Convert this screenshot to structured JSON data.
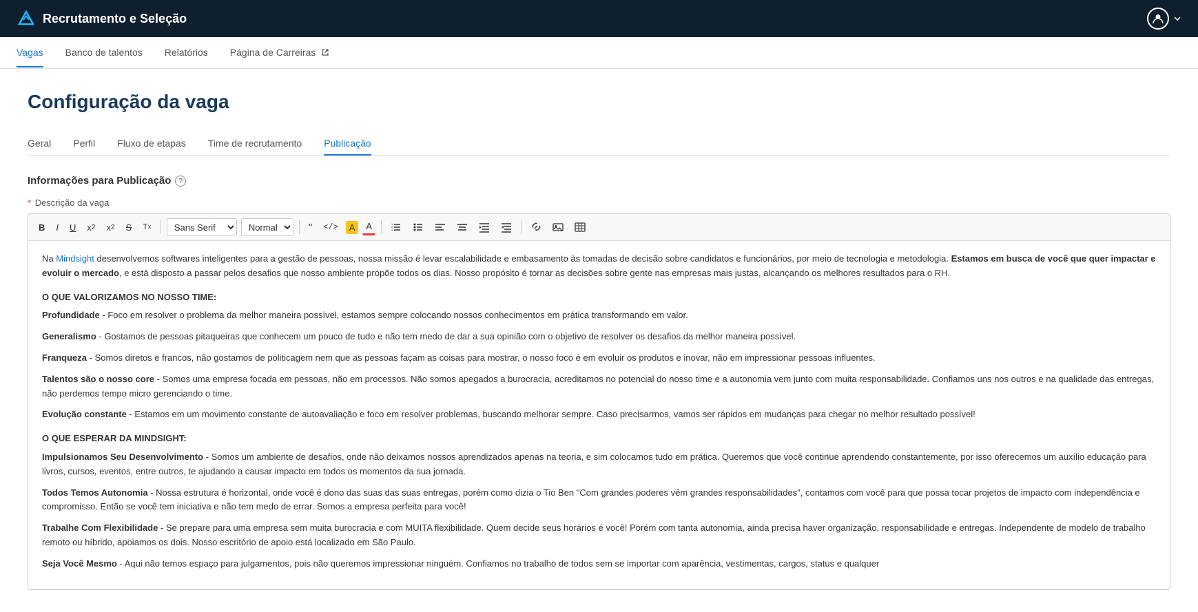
{
  "brand": {
    "name": "Recrutamento e Seleção"
  },
  "sub_nav": {
    "items": [
      {
        "id": "vagas",
        "label": "Vagas",
        "active": true
      },
      {
        "id": "banco-talentos",
        "label": "Banco de talentos",
        "active": false
      },
      {
        "id": "relatorios",
        "label": "Relatórios",
        "active": false
      },
      {
        "id": "pagina-carreiras",
        "label": "Página de Carreiras",
        "active": false,
        "external": true
      }
    ]
  },
  "page": {
    "title": "Configuração da vaga"
  },
  "tabs": [
    {
      "id": "geral",
      "label": "Geral",
      "active": false
    },
    {
      "id": "perfil",
      "label": "Perfil",
      "active": false
    },
    {
      "id": "fluxo-etapas",
      "label": "Fluxo de etapas",
      "active": false
    },
    {
      "id": "time-recrutamento",
      "label": "Time de recrutamento",
      "active": false
    },
    {
      "id": "publicacao",
      "label": "Publicação",
      "active": true
    }
  ],
  "section": {
    "title": "Informações para Publicação"
  },
  "field": {
    "label": "Descrição da vaga",
    "required": true
  },
  "toolbar": {
    "font_family": "Sans Serif",
    "font_size": "Normal"
  },
  "editor_content": {
    "intro": "Na Mindsight desenvolvemos softwares inteligentes para a gestão de pessoas, nossa missão é levar escalabilidade e embasamento às tomadas de decisão sobre candidatos e funcionários, por meio de tecnologia e metodologia.",
    "intro_bold": "Estamos em busca de você que quer impactar e evoluir o mercado",
    "intro_end": ", e está disposto a passar pelos desafios que nosso ambiente propõe todos os dias. Nosso propósito é tornar as decisões sobre gente nas empresas mais justas, alcançando os melhores resultados para o RH.",
    "section1_title": "O QUE VALORIZAMOS NO NOSSO TIME:",
    "items1": [
      {
        "title": "Profundidade",
        "text": " - Foco em resolver o problema da melhor maneira possível, estamos sempre colocando nossos conhecimentos em prática transformando em valor."
      },
      {
        "title": "Generalismo",
        "text": " - Gostamos de pessoas pitaqueiras que conhecem um pouco de tudo e não tem medo de dar a sua opinião com o objetivo de resolver os desafios da melhor maneira possível."
      },
      {
        "title": "Franqueza",
        "text": " - Somos diretos e francos, não gostamos de politicagem nem que as pessoas façam as coisas para mostrar, o nosso foco é em evoluir os produtos e inovar, não em impressionar pessoas influentes."
      },
      {
        "title": "Talentos são o nosso core",
        "text": " - Somos uma empresa focada em pessoas, não em processos. Não somos apegados a burocracia, acreditamos no potencial do nosso time e a autonomia vem junto com muita responsabilidade. Confiamos uns nos outros e na qualidade das entregas, não perdemos tempo micro gerenciando o time."
      },
      {
        "title": "Evolução constante",
        "text": " - Estamos em um movimento constante de autoavaliação e foco em resolver problemas, buscando melhorar sempre. Caso precisarmos, vamos ser rápidos em mudanças para chegar no melhor resultado possível!"
      }
    ],
    "section2_title": "O QUE ESPERAR DA MINDSIGHT:",
    "items2": [
      {
        "title": "Impulsionamos Seu Desenvolvimento",
        "text": " - Somos um ambiente de desafios, onde não deixamos nossos aprendizados apenas na teoria, e sim colocamos tudo em prática. Queremos que você continue aprendendo constantemente, por isso oferecemos um auxílio educação para livros, cursos, eventos, entre outros, te ajudando a causar impacto em todos os momentos da sua jornada."
      },
      {
        "title": "Todos Temos Autonomia",
        "text": " - Nossa estrutura é horizontal, onde você é dono das suas das suas entregas, porém como dizia o Tio Ben \"Com grandes poderes vêm grandes responsabilidades\", contamos com você para que possa tocar projetos de impacto com independência e compromisso. Então se você tem iniciativa e não tem medo de errar. Somos a empresa perfeita para você!"
      },
      {
        "title": "Trabalhe Com Flexibilidade",
        "text": " - Se prepare para uma empresa sem muita burocracia e com MUITA flexibilidade. Quem decide seus horários é você! Porém com tanta autonomia, ainda precisa haver organização, responsabilidade e entregas. Independente de modelo de trabalho remoto ou híbrido, apoiamos os dois. Nosso escritório de apoio está localizado em São Paulo."
      },
      {
        "title": "Seja Você Mesmo",
        "text": " - Aqui não temos espaço para julgamentos, pois não queremos impressionar ninguém. Confiamos no trabalho de todos sem se importar com aparência, vestimentas, cargos, status e qualquer"
      }
    ]
  }
}
